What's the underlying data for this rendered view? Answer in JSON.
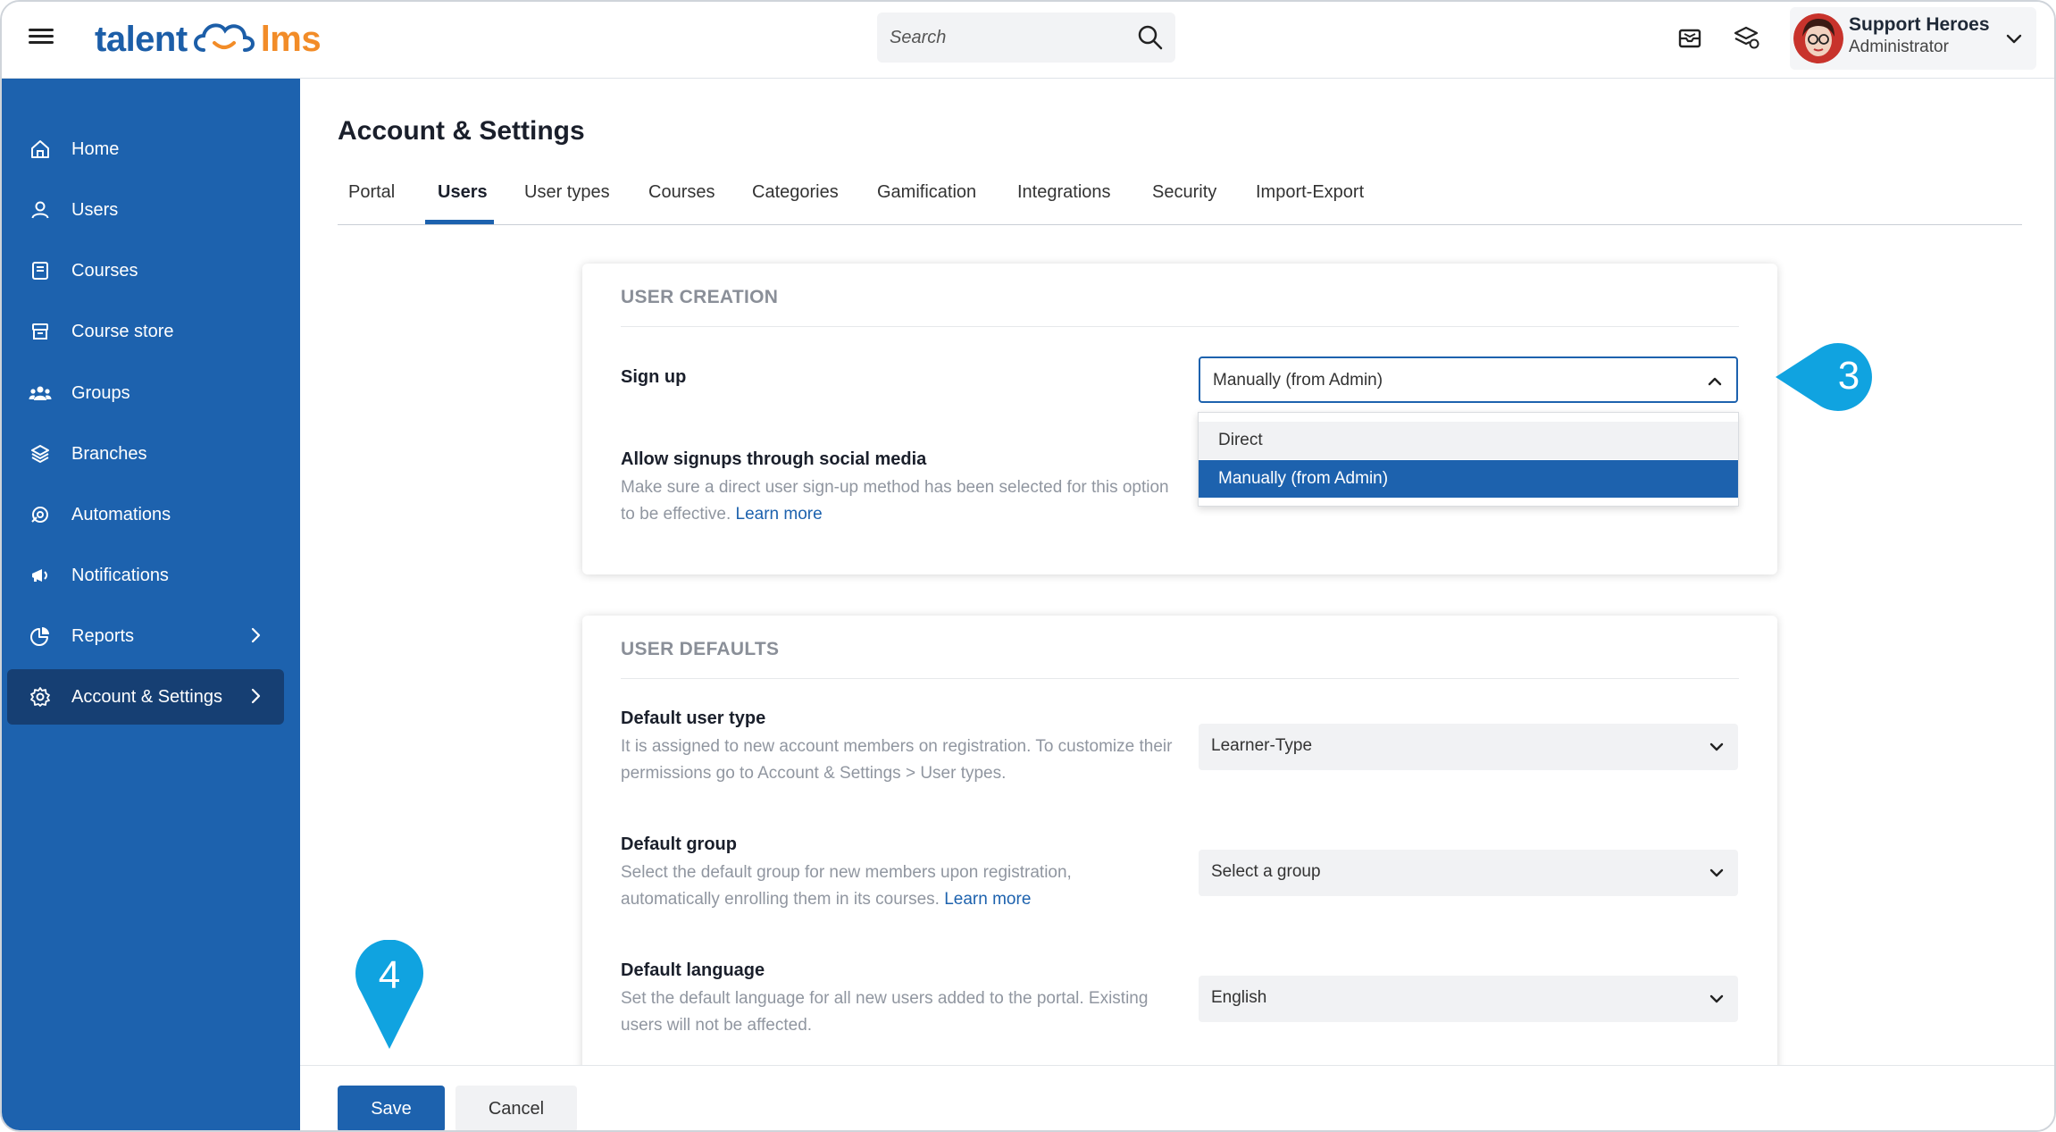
{
  "header": {
    "logo_left": "talent",
    "logo_right": "lms",
    "search_placeholder": "Search",
    "user_name": "Support Heroes",
    "user_role": "Administrator"
  },
  "sidebar": {
    "items": [
      {
        "label": "Home",
        "icon": "home-icon"
      },
      {
        "label": "Users",
        "icon": "user-icon"
      },
      {
        "label": "Courses",
        "icon": "book-icon"
      },
      {
        "label": "Course store",
        "icon": "store-icon"
      },
      {
        "label": "Groups",
        "icon": "groups-icon"
      },
      {
        "label": "Branches",
        "icon": "layers-icon"
      },
      {
        "label": "Automations",
        "icon": "automation-icon"
      },
      {
        "label": "Notifications",
        "icon": "megaphone-icon"
      },
      {
        "label": "Reports",
        "icon": "pie-chart-icon"
      },
      {
        "label": "Account & Settings",
        "icon": "gear-icon"
      }
    ],
    "active": "Account & Settings"
  },
  "page": {
    "title": "Account & Settings",
    "tabs": [
      "Portal",
      "Users",
      "User types",
      "Courses",
      "Categories",
      "Gamification",
      "Integrations",
      "Security",
      "Import-Export"
    ],
    "active_tab": "Users"
  },
  "user_creation": {
    "title": "USER CREATION",
    "signup_label": "Sign up",
    "signup_value": "Manually (from Admin)",
    "options": [
      "Direct",
      "Manually (from Admin)"
    ],
    "social_label": "Allow signups through social media",
    "social_desc": "Make sure a direct user sign-up method has been selected for this option to be effective.",
    "learn_more": "Learn more"
  },
  "user_defaults": {
    "title": "USER DEFAULTS",
    "type_label": "Default user type",
    "type_desc": "It is assigned to new account members on registration. To customize their permissions go to Account & Settings > User types.",
    "type_value": "Learner-Type",
    "group_label": "Default group",
    "group_desc": "Select the default group for new members upon registration, automatically enrolling them in its courses.",
    "group_learn_more": "Learn more",
    "group_value": "Select a group",
    "lang_label": "Default language",
    "lang_desc": "Set the default language for all new users added to the portal. Existing users will not be affected.",
    "lang_value": "English"
  },
  "footer": {
    "save": "Save",
    "cancel": "Cancel"
  },
  "callouts": {
    "step3": "3",
    "step4": "4"
  },
  "colors": {
    "brand_blue": "#1d62ae",
    "brand_orange": "#f28c28",
    "callout": "#10a3e0"
  }
}
